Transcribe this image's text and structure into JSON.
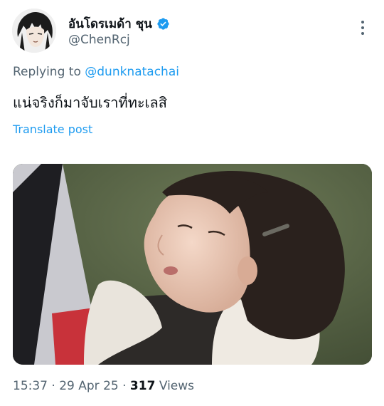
{
  "post": {
    "display_name": "อันโดรเมด้า ชุน",
    "handle": "@ChenRcj",
    "replying_prefix": "Replying to",
    "replying_to": "@dunknatachai",
    "text": "แน่จริงก็มาจับเราที่ทะเลสิ",
    "translate_label": "Translate post",
    "time": "15:37",
    "date": "29 Apr 25",
    "separator": "·",
    "views_count": "317",
    "views_label": "Views"
  },
  "icons": {
    "verified": "verified-badge-icon",
    "more": "more-options-icon"
  },
  "colors": {
    "accent": "#1d9bf0",
    "text_primary": "#0f1419",
    "text_secondary": "#536471"
  }
}
